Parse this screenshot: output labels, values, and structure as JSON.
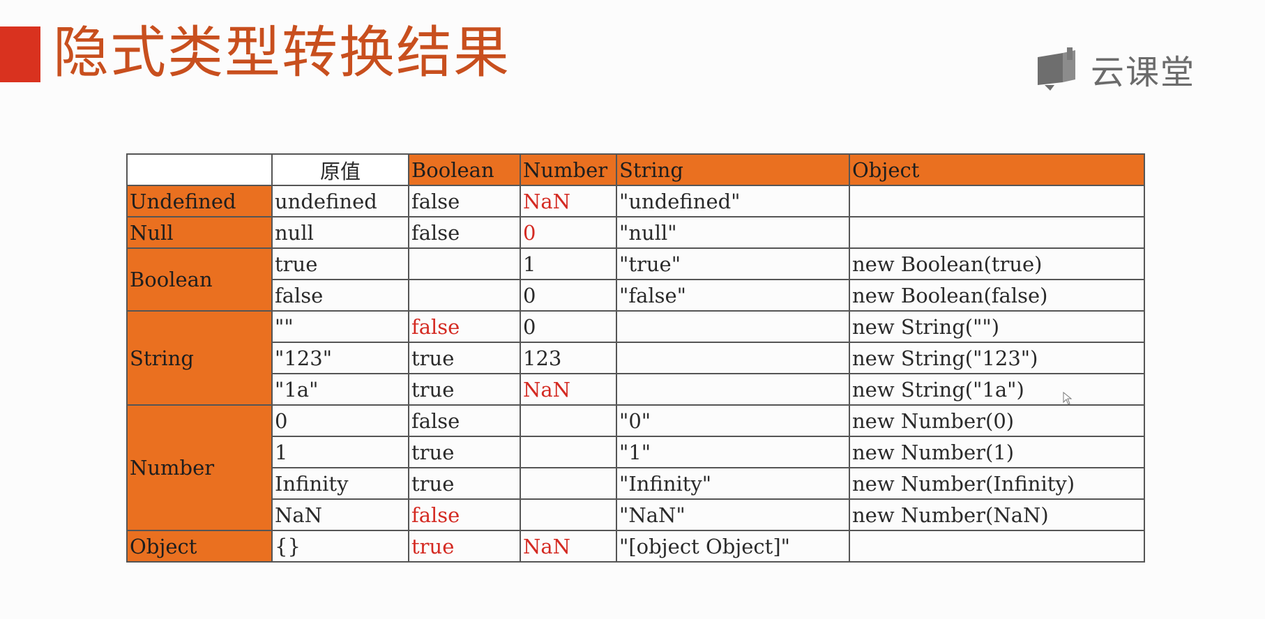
{
  "title": "隐式类型转换结果",
  "logo": {
    "text": "云课堂",
    "icon": "course-logo-icon"
  },
  "table": {
    "headers": [
      "",
      "原值",
      "Boolean",
      "Number",
      "String",
      "Object"
    ],
    "groups": [
      {
        "label": "Undefined",
        "rows": [
          [
            "undefined",
            "false",
            "NaN",
            "\"undefined\"",
            ""
          ]
        ]
      },
      {
        "label": "Null",
        "rows": [
          [
            "null",
            "false",
            "0",
            "\"null\"",
            ""
          ]
        ]
      },
      {
        "label": "Boolean",
        "rows": [
          [
            "true",
            "",
            "1",
            "\"true\"",
            "new Boolean(true)"
          ],
          [
            "false",
            "",
            "0",
            "\"false\"",
            "new Boolean(false)"
          ]
        ]
      },
      {
        "label": "String",
        "rows": [
          [
            "\"\"",
            "false",
            "0",
            "",
            "new String(\"\")"
          ],
          [
            "\"123\"",
            "true",
            "123",
            "",
            "new String(\"123\")"
          ],
          [
            "\"1a\"",
            "true",
            "NaN",
            "",
            "new String(\"1a\")"
          ]
        ]
      },
      {
        "label": "Number",
        "rows": [
          [
            "0",
            "false",
            "",
            "\"0\"",
            "new Number(0)"
          ],
          [
            "1",
            "true",
            "",
            "\"1\"",
            "new Number(1)"
          ],
          [
            "Infinity",
            "true",
            "",
            "\"Infinity\"",
            "new Number(Infinity)"
          ],
          [
            "NaN",
            "false",
            "",
            "\"NaN\"",
            "new Number(NaN)"
          ]
        ]
      },
      {
        "label": "Object",
        "rows": [
          [
            "{}",
            "true",
            "NaN",
            "\"[object Object]\"",
            ""
          ]
        ]
      }
    ]
  },
  "colors": {
    "header_bg": "#ea7020",
    "highlight_text": "#d42a22",
    "title": "#c84f1e",
    "title_bar": "#d9321f"
  }
}
